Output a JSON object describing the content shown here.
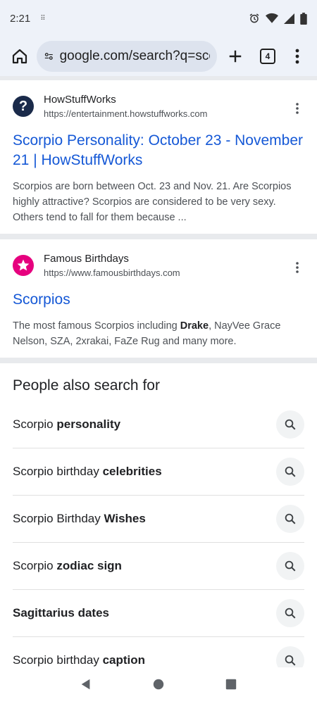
{
  "status_bar": {
    "time": "2:21",
    "icons": [
      "alarm-icon",
      "wifi-icon",
      "signal-icon",
      "battery-icon"
    ]
  },
  "toolbar": {
    "url": "google.com/search?q=scorpios",
    "tab_count": "4"
  },
  "results": [
    {
      "site_name": "HowStuffWorks",
      "site_url": "https://entertainment.howstuffworks.com",
      "title": "Scorpio Personality: October 23 - November 21 | HowStuffWorks",
      "snippet": "Scorpios are born between Oct. 23 and Nov. 21. Are Scorpios highly attractive? Scorpios are considered to be very sexy. Others tend to fall for them because ..."
    },
    {
      "site_name": "Famous Birthdays",
      "site_url": "https://www.famousbirthdays.com",
      "title": "Scorpios",
      "snippet_pre": "The most famous Scorpios including ",
      "snippet_bold": "Drake",
      "snippet_post": ", NayVee Grace Nelson, SZA, 2xrakai, FaZe Rug and many more."
    }
  ],
  "people_also_search": {
    "heading": "People also search for",
    "items": [
      {
        "plain": "Scorpio ",
        "bold": "personality"
      },
      {
        "plain": "Scorpio birthday ",
        "bold": "celebrities"
      },
      {
        "plain": "Scorpio Birthday ",
        "bold": "Wishes"
      },
      {
        "plain": "Scorpio ",
        "bold": "zodiac sign"
      },
      {
        "plain": "",
        "bold": "Sagittarius dates"
      },
      {
        "plain": "Scorpio birthday ",
        "bold": "caption"
      }
    ]
  },
  "colors": {
    "link": "#1558d6",
    "browser_chrome": "#eef2f9",
    "howstuffworks_brand": "#1a2a4a",
    "famousbirthdays_brand": "#e6007e"
  }
}
